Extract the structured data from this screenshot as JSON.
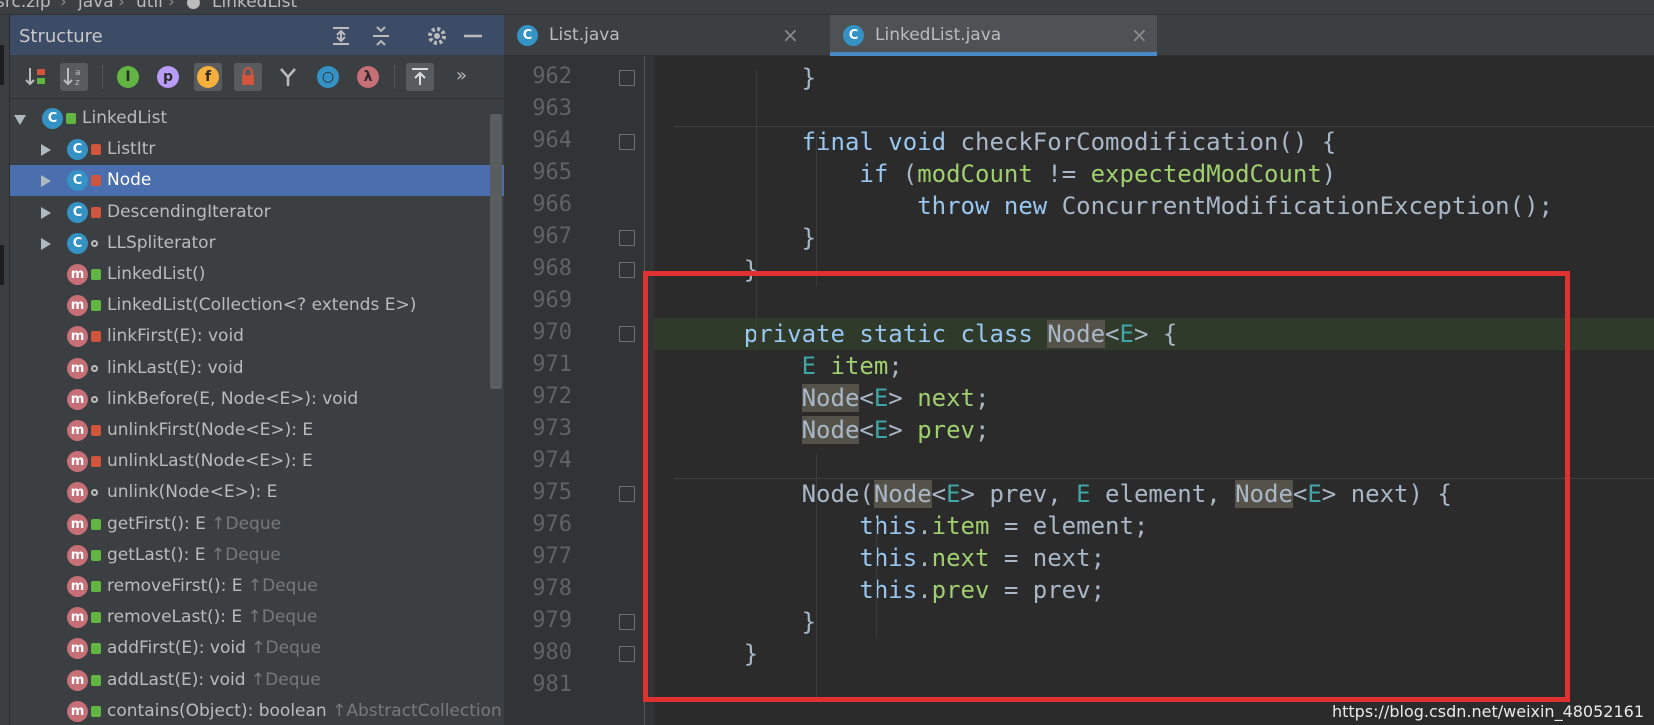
{
  "breadcrumb": {
    "items": [
      "src.zip",
      "java",
      "util",
      "LinkedList"
    ]
  },
  "structure": {
    "title": "Structure",
    "tree": [
      {
        "label": "LinkedList",
        "inherited": "",
        "kind": "class",
        "vis": "lock-green",
        "expanded": true,
        "depth": 0
      },
      {
        "label": "ListItr",
        "inherited": "",
        "kind": "class",
        "vis": "lock-red",
        "expanded": false,
        "depth": 1
      },
      {
        "label": "Node",
        "inherited": "",
        "kind": "class",
        "vis": "lock-red",
        "expanded": false,
        "depth": 1,
        "selected": true
      },
      {
        "label": "DescendingIterator",
        "inherited": "",
        "kind": "class",
        "vis": "lock-red",
        "expanded": false,
        "depth": 1
      },
      {
        "label": "LLSpliterator",
        "inherited": "",
        "kind": "class",
        "vis": "pkg",
        "expanded": false,
        "depth": 1
      },
      {
        "label": "LinkedList()",
        "inherited": "",
        "kind": "method",
        "vis": "lock-green",
        "depth": 1
      },
      {
        "label": "LinkedList(Collection<? extends E>)",
        "inherited": "",
        "kind": "method",
        "vis": "lock-green",
        "depth": 1
      },
      {
        "label": "linkFirst(E): void",
        "inherited": "",
        "kind": "method",
        "vis": "lock-red",
        "depth": 1
      },
      {
        "label": "linkLast(E): void",
        "inherited": "",
        "kind": "method",
        "vis": "pkg",
        "depth": 1
      },
      {
        "label": "linkBefore(E, Node<E>): void",
        "inherited": "",
        "kind": "method",
        "vis": "pkg",
        "depth": 1
      },
      {
        "label": "unlinkFirst(Node<E>): E",
        "inherited": "",
        "kind": "method",
        "vis": "lock-red",
        "depth": 1
      },
      {
        "label": "unlinkLast(Node<E>): E",
        "inherited": "",
        "kind": "method",
        "vis": "lock-red",
        "depth": 1
      },
      {
        "label": "unlink(Node<E>): E",
        "inherited": "",
        "kind": "method",
        "vis": "pkg",
        "depth": 1
      },
      {
        "label": "getFirst(): E",
        "inherited": "↑Deque",
        "kind": "method",
        "vis": "lock-green",
        "depth": 1
      },
      {
        "label": "getLast(): E",
        "inherited": "↑Deque",
        "kind": "method",
        "vis": "lock-green",
        "depth": 1
      },
      {
        "label": "removeFirst(): E",
        "inherited": "↑Deque",
        "kind": "method",
        "vis": "lock-green",
        "depth": 1
      },
      {
        "label": "removeLast(): E",
        "inherited": "↑Deque",
        "kind": "method",
        "vis": "lock-green",
        "depth": 1
      },
      {
        "label": "addFirst(E): void",
        "inherited": "↑Deque",
        "kind": "method",
        "vis": "lock-green",
        "depth": 1
      },
      {
        "label": "addLast(E): void",
        "inherited": "↑Deque",
        "kind": "method",
        "vis": "lock-green",
        "depth": 1
      },
      {
        "label": "contains(Object): boolean",
        "inherited": "↑AbstractCollection",
        "kind": "method",
        "vis": "lock-green",
        "depth": 1
      }
    ]
  },
  "editor": {
    "tabs": [
      {
        "label": "List.java",
        "active": false
      },
      {
        "label": "LinkedList.java",
        "active": true
      }
    ],
    "lines": [
      {
        "n": "962",
        "tokens": [
          [
            "",
            "        "
          ],
          [
            "",
            "}"
          ]
        ]
      },
      {
        "n": "963",
        "tokens": []
      },
      {
        "n": "964",
        "tokens": [
          [
            "",
            "        "
          ],
          [
            "k2",
            "final "
          ],
          [
            "k2",
            "void "
          ],
          [
            "",
            "checkForComodification() {"
          ]
        ]
      },
      {
        "n": "965",
        "tokens": [
          [
            "",
            "            "
          ],
          [
            "k2",
            "if "
          ],
          [
            "",
            "("
          ],
          [
            "fld",
            "modCount"
          ],
          [
            "",
            " != "
          ],
          [
            "fld",
            "expectedModCount"
          ],
          [
            "",
            ")"
          ]
        ]
      },
      {
        "n": "966",
        "tokens": [
          [
            "",
            "                "
          ],
          [
            "k2",
            "throw "
          ],
          [
            "k2",
            "new "
          ],
          [
            "",
            "ConcurrentModificationException();"
          ]
        ]
      },
      {
        "n": "967",
        "tokens": [
          [
            "",
            "        "
          ],
          [
            "",
            "}"
          ]
        ]
      },
      {
        "n": "968",
        "tokens": [
          [
            "",
            "    "
          ],
          [
            "",
            "}"
          ]
        ]
      },
      {
        "n": "969",
        "tokens": []
      },
      {
        "n": "970",
        "tokens": [
          [
            "",
            "    "
          ],
          [
            "k2",
            "private "
          ],
          [
            "k2",
            "static "
          ],
          [
            "k2",
            "class "
          ],
          [
            "nm",
            "Node"
          ],
          [
            "",
            "<"
          ],
          [
            "tp",
            "E"
          ],
          [
            "",
            "> {"
          ]
        ]
      },
      {
        "n": "971",
        "tokens": [
          [
            "",
            "        "
          ],
          [
            "tp",
            "E "
          ],
          [
            "fld",
            "item"
          ],
          [
            "",
            ";"
          ]
        ]
      },
      {
        "n": "972",
        "tokens": [
          [
            "",
            "        "
          ],
          [
            "nm",
            "Node"
          ],
          [
            "",
            "<"
          ],
          [
            "tp",
            "E"
          ],
          [
            "",
            "> "
          ],
          [
            "fld",
            "next"
          ],
          [
            "",
            ";"
          ]
        ]
      },
      {
        "n": "973",
        "tokens": [
          [
            "",
            "        "
          ],
          [
            "nm",
            "Node"
          ],
          [
            "",
            "<"
          ],
          [
            "tp",
            "E"
          ],
          [
            "",
            "> "
          ],
          [
            "fld",
            "prev"
          ],
          [
            "",
            ";"
          ]
        ]
      },
      {
        "n": "974",
        "tokens": []
      },
      {
        "n": "975",
        "tokens": [
          [
            "",
            "        "
          ],
          [
            "",
            "Node("
          ],
          [
            "nm",
            "Node"
          ],
          [
            "",
            "<"
          ],
          [
            "tp",
            "E"
          ],
          [
            "",
            "> prev, "
          ],
          [
            "tp",
            "E"
          ],
          [
            "",
            " element, "
          ],
          [
            "nm",
            "Node"
          ],
          [
            "",
            "<"
          ],
          [
            "tp",
            "E"
          ],
          [
            "",
            "> next) {"
          ]
        ]
      },
      {
        "n": "976",
        "tokens": [
          [
            "",
            "            "
          ],
          [
            "k2",
            "this"
          ],
          [
            "",
            "."
          ],
          [
            "fld",
            "item"
          ],
          [
            "",
            " = element;"
          ]
        ]
      },
      {
        "n": "977",
        "tokens": [
          [
            "",
            "            "
          ],
          [
            "k2",
            "this"
          ],
          [
            "",
            "."
          ],
          [
            "fld",
            "next"
          ],
          [
            "",
            " = next;"
          ]
        ]
      },
      {
        "n": "978",
        "tokens": [
          [
            "",
            "            "
          ],
          [
            "k2",
            "this"
          ],
          [
            "",
            "."
          ],
          [
            "fld",
            "prev"
          ],
          [
            "",
            " = prev;"
          ]
        ]
      },
      {
        "n": "979",
        "tokens": [
          [
            "",
            "        "
          ],
          [
            "",
            "}"
          ]
        ]
      },
      {
        "n": "980",
        "tokens": [
          [
            "",
            "    "
          ],
          [
            "",
            "}"
          ]
        ]
      },
      {
        "n": "981",
        "tokens": []
      }
    ]
  },
  "watermark": "https://blog.csdn.net/weixin_48052161",
  "colors": {
    "accent": "#4a88c7",
    "selection": "#4b6eaf",
    "annotation_box": "#e03131"
  }
}
